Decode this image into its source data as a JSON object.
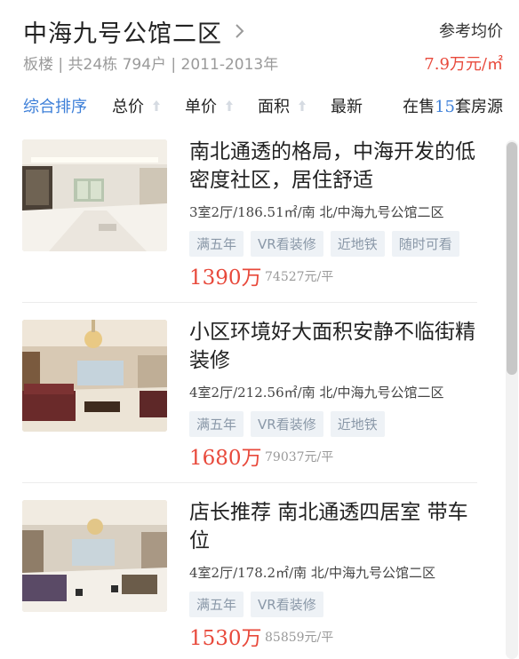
{
  "community": {
    "title": "中海九号公馆二区",
    "meta": "板楼 | 共24栋 794户 | 2011-2013年",
    "avg_label": "参考均价",
    "avg_price": "7.9万元/㎡"
  },
  "sort": {
    "items": [
      {
        "label": "综合排序",
        "active": true
      },
      {
        "label": "总价"
      },
      {
        "label": "单价"
      },
      {
        "label": "面积"
      },
      {
        "label": "最新"
      }
    ],
    "onsale_prefix": "在售",
    "onsale_count": "15",
    "onsale_suffix": "套房源"
  },
  "listings": [
    {
      "title": "南北通透的格局，中海开发的低密度社区，居住舒适",
      "desc": "3室2厅/186.51㎡/南 北/中海九号公馆二区",
      "tags": [
        "满五年",
        "VR看装修",
        "近地铁",
        "随时可看"
      ],
      "price": "1390万",
      "unit_price": "74527元/平"
    },
    {
      "title": "小区环境好大面积安静不临街精装修",
      "desc": "4室2厅/212.56㎡/南 北/中海九号公馆二区",
      "tags": [
        "满五年",
        "VR看装修",
        "近地铁"
      ],
      "price": "1680万",
      "unit_price": "79037元/平"
    },
    {
      "title": "店长推荐 南北通透四居室 带车位",
      "desc": "4室2厅/178.2㎡/南 北/中海九号公馆二区",
      "tags": [
        "满五年",
        "VR看装修"
      ],
      "price": "1530万",
      "unit_price": "85859元/平"
    }
  ],
  "colors": {
    "accent": "#3d7fd8",
    "price": "#e8493b"
  }
}
